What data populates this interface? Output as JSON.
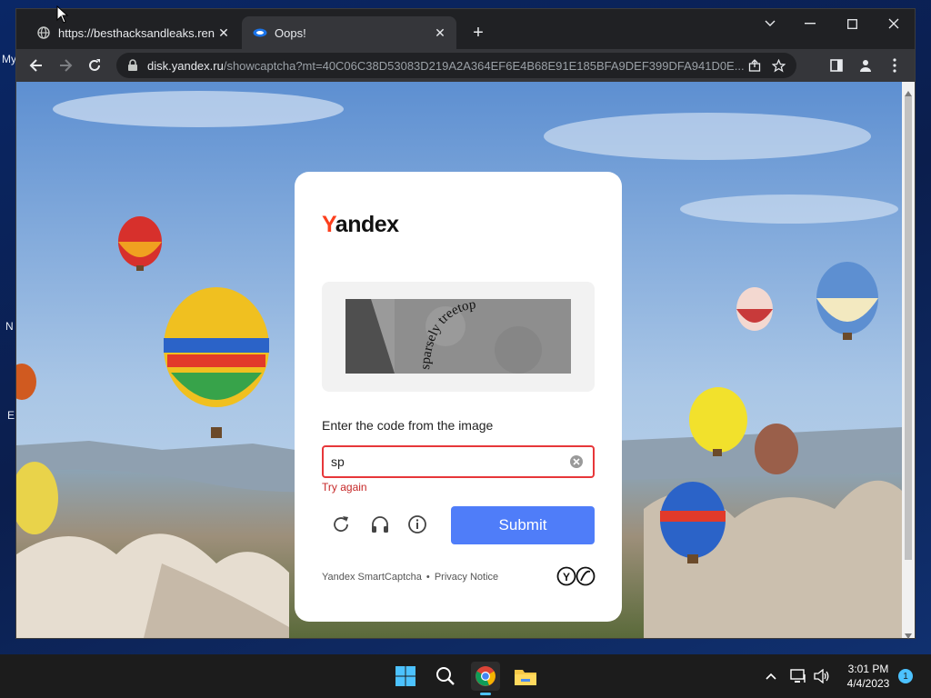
{
  "desktop": {
    "labels": [
      "My",
      "N",
      "E"
    ]
  },
  "browser": {
    "tabs": [
      {
        "title": "https://besthacksandleaks.render",
        "active": false
      },
      {
        "title": "Oops!",
        "active": true
      }
    ],
    "new_tab_label": "+",
    "url": {
      "host": "disk.yandex.ru",
      "path": "/showcaptcha?mt=40C06C38D53083D219A2A364EF6E4B68E91E185BFA9DEF399DFA941D0E..."
    }
  },
  "captcha": {
    "logo": {
      "first_letter": "Y",
      "rest": "andex"
    },
    "image_text": "sparsely treetop",
    "prompt": "Enter the code from the image",
    "input_value": "sp",
    "error": "Try again",
    "submit_label": "Submit",
    "footer": {
      "brand_link": "Yandex SmartCaptcha",
      "separator": "•",
      "privacy_link": "Privacy Notice"
    }
  },
  "taskbar": {
    "time": "3:01 PM",
    "date": "4/4/2023",
    "notifications": "1"
  },
  "colors": {
    "accent": "#4f7df9",
    "error": "#e7373a",
    "yandex_red": "#fc3f1d"
  }
}
